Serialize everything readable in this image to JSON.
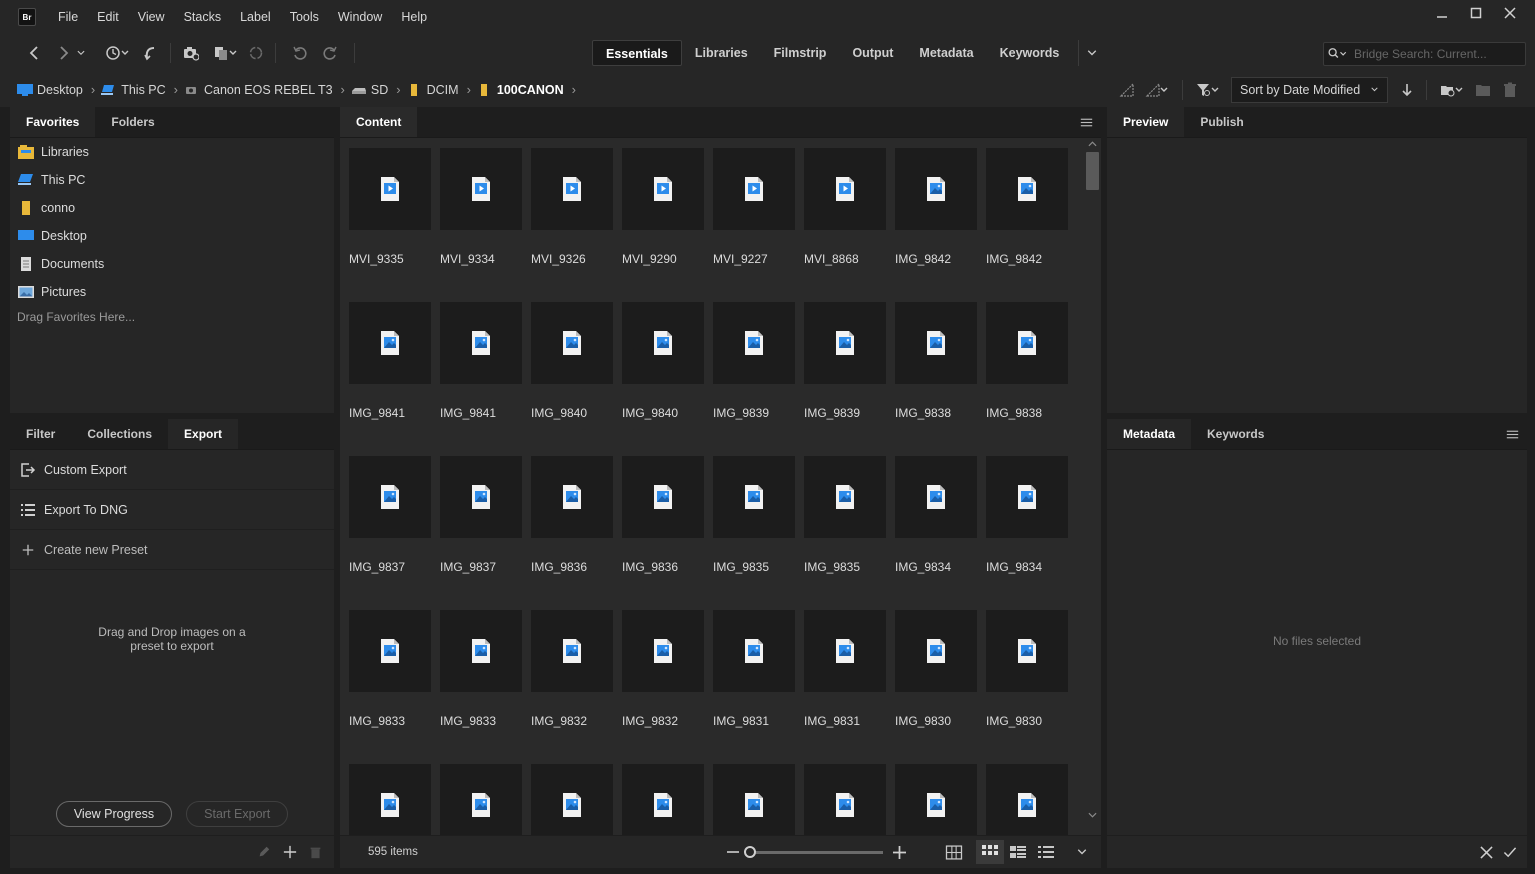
{
  "app": {
    "logo_text": "Br"
  },
  "menubar": {
    "items": [
      "File",
      "Edit",
      "View",
      "Stacks",
      "Label",
      "Tools",
      "Window",
      "Help"
    ]
  },
  "workspaces": {
    "tabs": [
      "Essentials",
      "Libraries",
      "Filmstrip",
      "Output",
      "Metadata",
      "Keywords"
    ],
    "active": "Essentials"
  },
  "search": {
    "placeholder": "Bridge Search: Current..."
  },
  "breadcrumb": [
    {
      "label": "Desktop",
      "icon": "desktop-icon"
    },
    {
      "label": "This PC",
      "icon": "computer-icon"
    },
    {
      "label": "Canon EOS REBEL T3",
      "icon": "camera-icon"
    },
    {
      "label": "SD",
      "icon": "drive-icon"
    },
    {
      "label": "DCIM",
      "icon": "folder-icon"
    },
    {
      "label": "100CANON",
      "icon": "folder-icon"
    }
  ],
  "sort": {
    "label": "Sort by Date Modified"
  },
  "favorites_panel": {
    "tabs": [
      "Favorites",
      "Folders"
    ],
    "active": "Favorites",
    "items": [
      {
        "label": "Libraries",
        "icon": "libraries-icon"
      },
      {
        "label": "This PC",
        "icon": "computer-icon"
      },
      {
        "label": "conno",
        "icon": "user-folder-icon"
      },
      {
        "label": "Desktop",
        "icon": "desktop-icon"
      },
      {
        "label": "Documents",
        "icon": "documents-icon"
      },
      {
        "label": "Pictures",
        "icon": "pictures-icon"
      }
    ],
    "hint": "Drag Favorites Here..."
  },
  "export_panel": {
    "tabs": [
      "Filter",
      "Collections",
      "Export"
    ],
    "active": "Export",
    "items": [
      "Custom Export",
      "Export To DNG",
      "Create new Preset"
    ],
    "drop_hint_line1": "Drag and Drop images on a",
    "drop_hint_line2": "preset to export",
    "view_progress": "View Progress",
    "start_export": "Start Export"
  },
  "content_panel": {
    "tab": "Content",
    "rows": [
      {
        "names": [
          "MVI_9335",
          "MVI_9334",
          "MVI_9326",
          "MVI_9290",
          "MVI_9227",
          "MVI_8868",
          "IMG_9842",
          "IMG_9842"
        ],
        "kinds": [
          "video",
          "video",
          "video",
          "video",
          "video",
          "video",
          "image",
          "image"
        ]
      },
      {
        "names": [
          "IMG_9841",
          "IMG_9841",
          "IMG_9840",
          "IMG_9840",
          "IMG_9839",
          "IMG_9839",
          "IMG_9838",
          "IMG_9838"
        ],
        "kinds": [
          "image",
          "image",
          "image",
          "image",
          "image",
          "image",
          "image",
          "image"
        ]
      },
      {
        "names": [
          "IMG_9837",
          "IMG_9837",
          "IMG_9836",
          "IMG_9836",
          "IMG_9835",
          "IMG_9835",
          "IMG_9834",
          "IMG_9834"
        ],
        "kinds": [
          "image",
          "image",
          "image",
          "image",
          "image",
          "image",
          "image",
          "image"
        ]
      },
      {
        "names": [
          "IMG_9833",
          "IMG_9833",
          "IMG_9832",
          "IMG_9832",
          "IMG_9831",
          "IMG_9831",
          "IMG_9830",
          "IMG_9830"
        ],
        "kinds": [
          "image",
          "image",
          "image",
          "image",
          "image",
          "image",
          "image",
          "image"
        ]
      },
      {
        "names": [
          "",
          "",
          "",
          "",
          "",
          "",
          "",
          ""
        ],
        "kinds": [
          "image",
          "image",
          "image",
          "image",
          "image",
          "image",
          "image",
          "image"
        ]
      }
    ],
    "item_count": "595 items"
  },
  "preview_panel": {
    "tabs": [
      "Preview",
      "Publish"
    ],
    "active": "Preview"
  },
  "metadata_panel": {
    "tabs": [
      "Metadata",
      "Keywords"
    ],
    "active": "Metadata",
    "empty_text": "No files selected"
  },
  "colors": {
    "accent_blue": "#2d8ceb",
    "folder_yellow": "#e8b83a",
    "panel_bg": "#262626",
    "thumb_bg": "#1c1c1c"
  }
}
